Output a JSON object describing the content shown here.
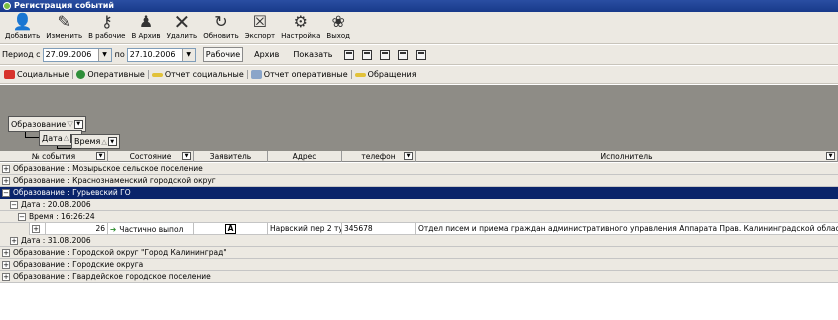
{
  "window": {
    "title": "Регистрация событий"
  },
  "toolbar": {
    "buttons": [
      {
        "label": "Добавить",
        "icon": "person-add-icon"
      },
      {
        "label": "Изменить",
        "icon": "pencil-icon"
      },
      {
        "label": "В рабочие",
        "icon": "key-icon"
      },
      {
        "label": "В Архив",
        "icon": "archive-person-icon"
      },
      {
        "label": "Удалить",
        "icon": "delete-x-icon"
      },
      {
        "label": "Обновить",
        "icon": "refresh-icon"
      },
      {
        "label": "Экспорт",
        "icon": "export-excel-icon"
      },
      {
        "label": "Настройка",
        "icon": "settings-gear-icon"
      },
      {
        "label": "Выход",
        "icon": "exit-icon"
      }
    ]
  },
  "period": {
    "from_label": "Период с",
    "from_value": "27.09.2006",
    "to_label": "по",
    "to_value": "27.10.2006",
    "working_label": "Рабочие",
    "archive_label": "Архив",
    "show_label": "Показать"
  },
  "tabs": [
    "Социальные",
    "Оперативные",
    "Отчет социальные",
    "Отчет оперативные",
    "Обращения"
  ],
  "grouping": {
    "level1": "Образование",
    "level2": "Дата",
    "level3": "Время"
  },
  "columns": [
    "№ события",
    "Состояние",
    "Заявитель",
    "Адрес",
    "телефон",
    "Исполнитель"
  ],
  "groups": {
    "g1": "Образование : Мозырьское сельское поселение",
    "g2": "Образование : Краснознаменский городской округ",
    "g3": "Образование : Гурьевский ГО",
    "g3_date1": "Дата : 20.08.2006",
    "g3_time1": "Время : 16:26:24",
    "g3_date2": "Дата : 31.08.2006",
    "g4": "Образование : Городской округ \"Город Калининград\"",
    "g5": "Образование : Городские округа",
    "g6": "Образование : Гвардейское городское поселение"
  },
  "record": {
    "number": "26",
    "state": "Частично выпол",
    "applicant_icon": "letter-a-icon",
    "address": "Нарвский пер 2 ту",
    "phone": "345678",
    "executor": "Отдел писем и приема граждан административного управления Аппарата Прав. Калининградской области"
  }
}
